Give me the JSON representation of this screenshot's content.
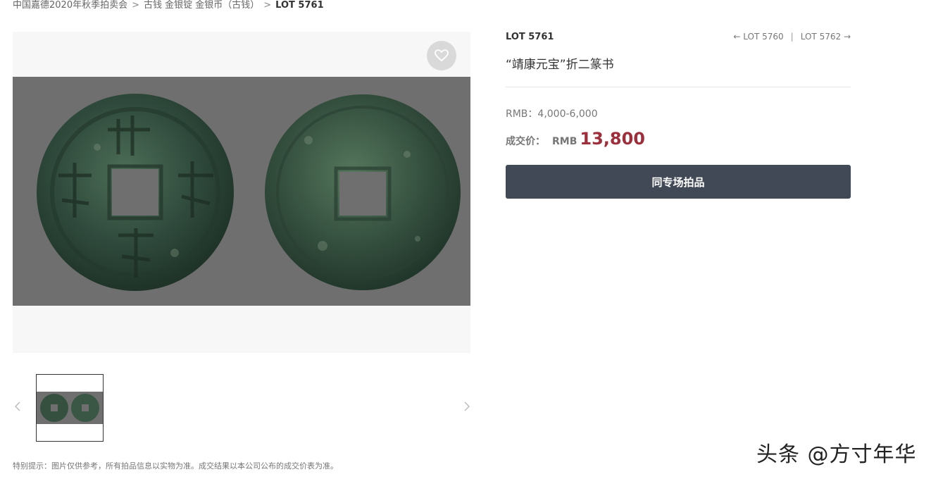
{
  "breadcrumb": {
    "auction": "中国嘉德2020年秋季拍卖会",
    "category": "古钱 金银锭 金银币（古钱）",
    "current": "LOT 5761",
    "separator": ">"
  },
  "gallery": {
    "favorite_icon": "heart-icon",
    "prev_icon": "chevron-left-icon",
    "next_icon": "chevron-right-icon",
    "photo_background": "#6f6f6f",
    "coin_colors": [
      "#2f4a3c",
      "#3d5a48",
      "#5a7a5e"
    ]
  },
  "disclaimer": "特别提示：图片仅供参考，所有拍品信息以实物为准。成交结果以本公司公布的成交价表为准。",
  "lot": {
    "number": "LOT 5761",
    "prev": "LOT 5760",
    "next": "LOT 5762",
    "title": "“靖康元宝”折二篆书",
    "estimate": "RMB：4,000-6,000",
    "sold_label": "成交价：",
    "sold_currency": "RMB",
    "sold_price": "13,800",
    "same_session_button": "同专场拍品"
  },
  "colors": {
    "accent_price": "#9b2f3b",
    "button_bg": "#414957"
  },
  "watermark": "头条 @方寸年华"
}
